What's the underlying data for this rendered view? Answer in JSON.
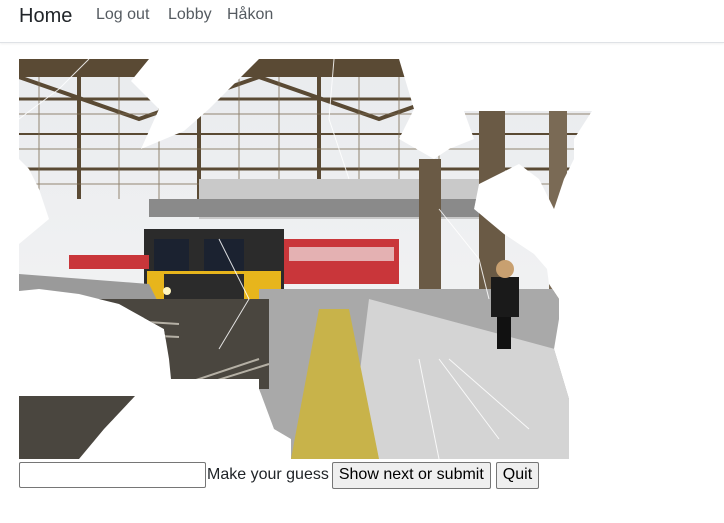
{
  "navbar": {
    "brand": "Home",
    "links": [
      {
        "label": "Log out"
      },
      {
        "label": "Lobby"
      },
      {
        "label": "Håkon"
      }
    ]
  },
  "puzzle": {
    "palette": {
      "sky": "#f1f3f5",
      "roof_steel": "#5a4a34",
      "roof_light": "#d9d3c6",
      "train_body": "#2b2b2b",
      "train_yellow": "#e7b51c",
      "train_red": "#c9363a",
      "platform": "#a9a9a9",
      "platform_light": "#d4d4d4",
      "tactile_yellow": "#c8b34a",
      "track": "#4a463f",
      "pillar": "#6a5a45",
      "person": "#1a1a1a"
    }
  },
  "controls": {
    "guess_input": {
      "value": "",
      "placeholder": ""
    },
    "guess_label": "Make your guess",
    "next_button": "Show next or submit",
    "quit_button": "Quit"
  }
}
